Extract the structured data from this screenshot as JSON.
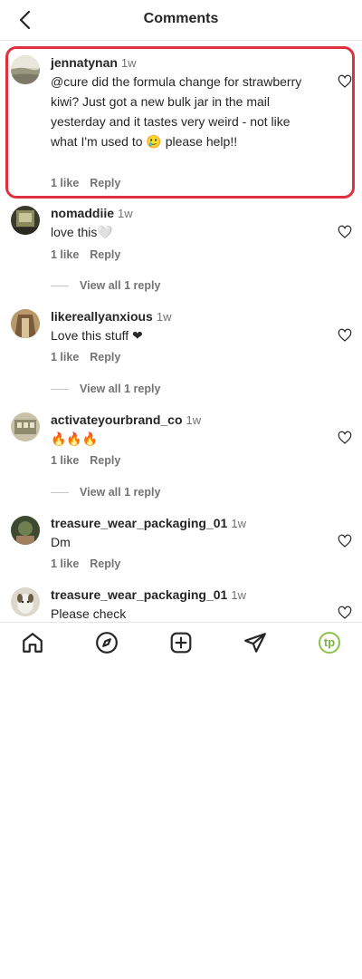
{
  "header": {
    "title": "Comments",
    "back_icon": "chevron-left-icon"
  },
  "comments": [
    {
      "username": "jennatynan",
      "time": "1w",
      "text": "@cure did the formula change for strawberry kiwi? Just got a new bulk jar in the mail yesterday and it tastes very weird - not like what I'm used to 🥲 please help!!",
      "likes": "1 like",
      "reply": "Reply",
      "highlighted": true
    },
    {
      "username": "nomaddiie",
      "time": "1w",
      "text": "love this🤍",
      "likes": "1 like",
      "reply": "Reply",
      "view_replies": "View all 1 reply"
    },
    {
      "username": "likereallyanxious",
      "time": "1w",
      "text": "Love this stuff ❤",
      "likes": "1 like",
      "reply": "Reply",
      "view_replies": "View all 1 reply"
    },
    {
      "username": "activateyourbrand_co",
      "time": "1w",
      "text": "🔥🔥🔥",
      "likes": "1 like",
      "reply": "Reply",
      "view_replies": "View all 1 reply"
    },
    {
      "username": "treasure_wear_packaging_01",
      "time": "1w",
      "text": "Dm",
      "likes": "1 like",
      "reply": "Reply"
    },
    {
      "username": "treasure_wear_packaging_01",
      "time": "1w",
      "text": "Please check"
    }
  ],
  "tabbar": {
    "items": [
      "home-icon",
      "explore-compass-icon",
      "create-plus-icon",
      "direct-send-icon"
    ],
    "profile_initials": "tp"
  },
  "colors": {
    "highlight": "#e0303f",
    "profile_ring": "#8bc34a"
  }
}
